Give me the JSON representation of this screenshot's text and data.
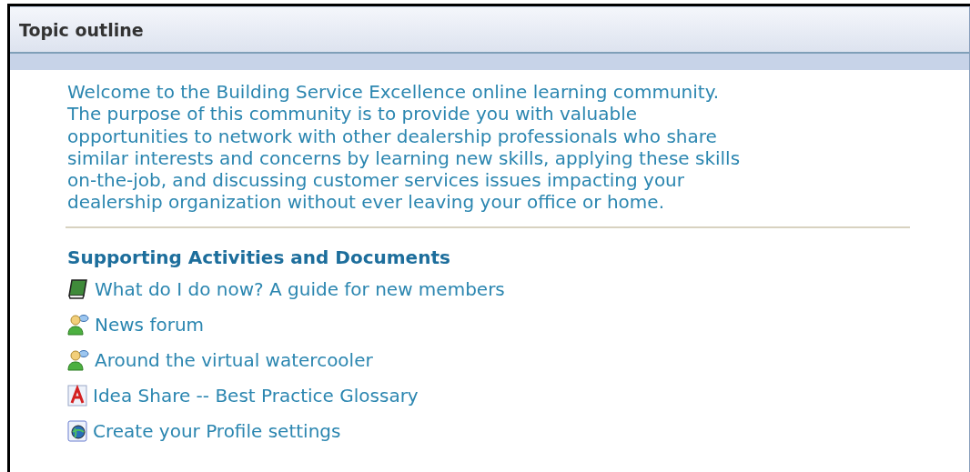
{
  "panel": {
    "title": "Topic outline"
  },
  "intro": {
    "lines": [
      "Welcome to the Building Service Excellence online learning community.",
      "The purpose of this community is to provide you with valuable",
      "opportunities to network with other dealership professionals who share",
      "similar interests and concerns by learning new skills, applying these skills",
      "on-the-job, and discussing customer services issues impacting your",
      "dealership organization without ever leaving your office or home."
    ]
  },
  "section": {
    "heading": "Supporting Activities and Documents",
    "items": [
      {
        "kind": "book",
        "label": "What do I do now? A guide for new members"
      },
      {
        "kind": "forum",
        "label": "News forum"
      },
      {
        "kind": "forum",
        "label": "Around the virtual watercooler"
      },
      {
        "kind": "glossary",
        "label": "Idea Share -- Best Practice Glossary"
      },
      {
        "kind": "profile",
        "label": "Create your Profile settings"
      }
    ]
  }
}
